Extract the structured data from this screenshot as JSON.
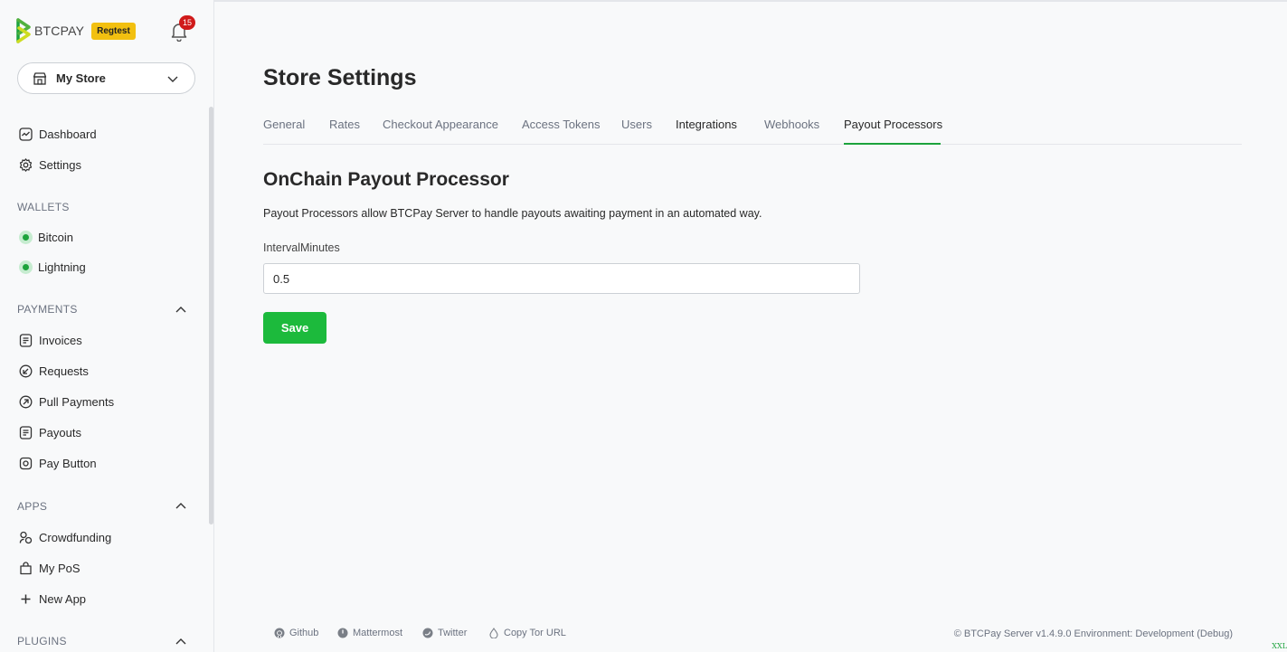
{
  "brand": {
    "name": "BTCPAY",
    "env_badge": "Regtest",
    "notification_count": "15"
  },
  "store_selector": {
    "value": "My Store"
  },
  "sidebar": {
    "main_items": [
      {
        "label": "Dashboard",
        "icon": "dashboard-icon"
      },
      {
        "label": "Settings",
        "icon": "gear-icon"
      }
    ],
    "wallets": {
      "title": "WALLETS",
      "items": [
        {
          "label": "Bitcoin"
        },
        {
          "label": "Lightning"
        }
      ]
    },
    "payments": {
      "title": "PAYMENTS",
      "items": [
        {
          "label": "Invoices",
          "icon": "invoice-icon"
        },
        {
          "label": "Requests",
          "icon": "request-icon"
        },
        {
          "label": "Pull Payments",
          "icon": "pull-payment-icon"
        },
        {
          "label": "Payouts",
          "icon": "payout-icon"
        },
        {
          "label": "Pay Button",
          "icon": "pay-button-icon"
        }
      ]
    },
    "apps": {
      "title": "APPS",
      "items": [
        {
          "label": "Crowdfunding",
          "icon": "crowdfund-icon"
        },
        {
          "label": "My PoS",
          "icon": "pos-icon"
        },
        {
          "label": "New App",
          "icon": "plus-icon"
        }
      ]
    },
    "plugins": {
      "title": "PLUGINS"
    }
  },
  "main": {
    "page_title": "Store Settings",
    "tabs": [
      {
        "label": "General"
      },
      {
        "label": "Rates"
      },
      {
        "label": "Checkout Appearance"
      },
      {
        "label": "Access Tokens"
      },
      {
        "label": "Users"
      },
      {
        "label": "Integrations"
      },
      {
        "label": "Webhooks"
      },
      {
        "label": "Payout Processors"
      }
    ],
    "active_tab": "Payout Processors",
    "section_title": "OnChain Payout Processor",
    "description": "Payout Processors allow BTCPay Server to handle payouts awaiting payment in an automated way.",
    "field": {
      "label": "IntervalMinutes",
      "value": "0.5"
    },
    "save_label": "Save"
  },
  "footer": {
    "links": [
      {
        "label": "Github",
        "icon": "github-icon"
      },
      {
        "label": "Mattermost",
        "icon": "mattermost-icon"
      },
      {
        "label": "Twitter",
        "icon": "twitter-icon"
      },
      {
        "label": "Copy Tor URL",
        "icon": "tor-icon"
      }
    ],
    "version_text": "© BTCPay Server v1.4.9.0 Environment: Development (Debug)"
  },
  "corner_tag": "XXL",
  "colors": {
    "accent": "#1cba3c",
    "badge": "#f2c010",
    "notification": "#d01a1a"
  }
}
